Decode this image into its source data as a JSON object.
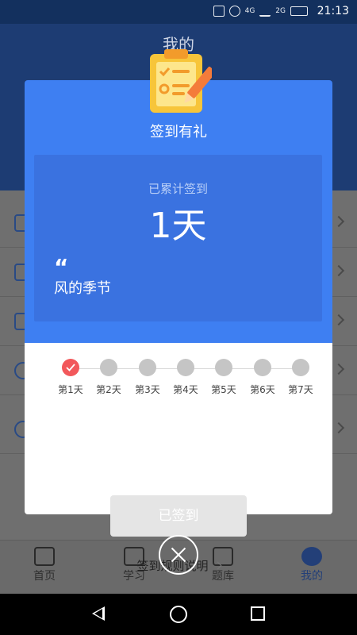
{
  "status_bar": {
    "time": "21:13",
    "net_labels": [
      "4G",
      "2G"
    ]
  },
  "page": {
    "title": "我的"
  },
  "modal": {
    "title": "签到有礼",
    "total_label": "已累计签到",
    "total_value": "1天",
    "quote_mark": "“",
    "quote_text": "风的季节",
    "days": [
      {
        "label": "第1天",
        "checked": true
      },
      {
        "label": "第2天",
        "checked": false
      },
      {
        "label": "第3天",
        "checked": false
      },
      {
        "label": "第4天",
        "checked": false
      },
      {
        "label": "第5天",
        "checked": false
      },
      {
        "label": "第6天",
        "checked": false
      },
      {
        "label": "第7天",
        "checked": false
      }
    ],
    "checkin_button": "已签到",
    "rules_link": "签到规则说明"
  },
  "tabbar": {
    "tabs": [
      {
        "label": "首页",
        "icon": "home-icon"
      },
      {
        "label": "学习",
        "icon": "study-icon"
      },
      {
        "label": "题库",
        "icon": "question-bank-icon"
      },
      {
        "label": "我的",
        "icon": "profile-icon",
        "active": true
      }
    ]
  },
  "colors": {
    "primary": "#3e7ff2",
    "header": "#1d3c73",
    "checked": "#f2585b"
  }
}
